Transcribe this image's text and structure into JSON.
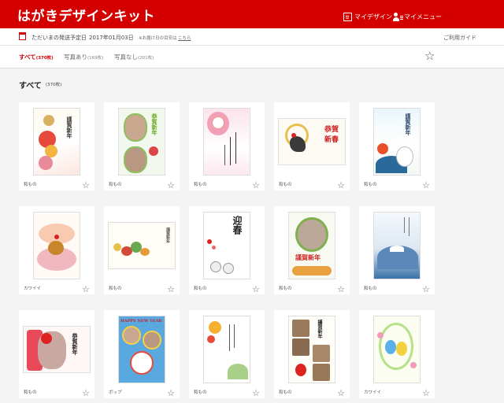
{
  "app": {
    "title": "はがきデザインキット"
  },
  "header": {
    "my_design_label": "マイデザイン",
    "my_menu_label": "マイメニュー"
  },
  "info": {
    "label": "ただいまの発送予定日",
    "date": "2017年01月03日",
    "note": "※お届け日の目安は",
    "link": "こちら",
    "guide": "ご利用ガイド"
  },
  "tabs": [
    {
      "label": "すべて",
      "count": "(370枚)"
    },
    {
      "label": "写真あり",
      "count": "(169枚)"
    },
    {
      "label": "写真なし",
      "count": "(201枚)"
    }
  ],
  "section": {
    "title": "すべて",
    "count": "(370枚)"
  },
  "cards": [
    {
      "category": "和もの",
      "title": "謹賀新年"
    },
    {
      "category": "和もの",
      "title": "恭賀新年"
    },
    {
      "category": "和もの",
      "title": ""
    },
    {
      "category": "和もの",
      "title": "恭賀新春"
    },
    {
      "category": "和もの",
      "title": "謹賀新年"
    },
    {
      "category": "カワイイ",
      "title": ""
    },
    {
      "category": "和もの",
      "title": "謹賀新年"
    },
    {
      "category": "和もの",
      "title": "迎春"
    },
    {
      "category": "和もの",
      "title": "謹賀新年"
    },
    {
      "category": "和もの",
      "title": ""
    },
    {
      "category": "和もの",
      "title": "恭賀新年"
    },
    {
      "category": "ポップ",
      "title": "HAPPY NEW YEAR"
    },
    {
      "category": "和もの",
      "title": ""
    },
    {
      "category": "和もの",
      "title": "謹賀新年"
    },
    {
      "category": "カワイイ",
      "title": ""
    }
  ],
  "colors": {
    "brand": "#d40000",
    "accent_gold": "#c8a040"
  },
  "icons": {
    "star": "star-icon",
    "calendar": "calendar-icon",
    "design": "design-icon",
    "user_menu": "user-menu-icon"
  }
}
